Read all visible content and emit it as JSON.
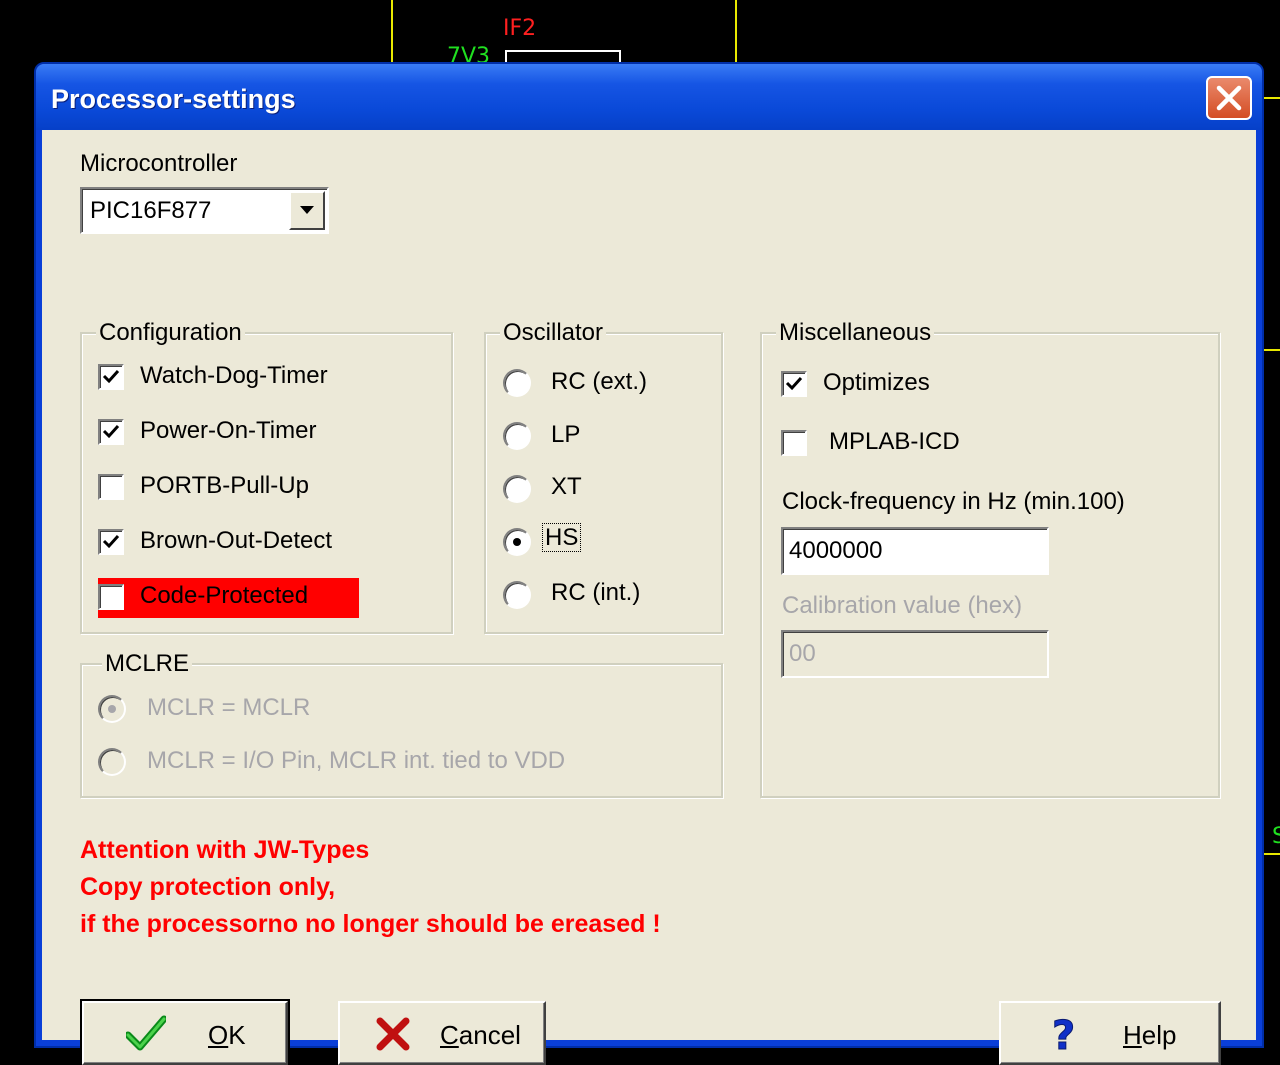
{
  "background": {
    "label_red": "IF2",
    "label_green": "7V3",
    "label_edge": "S"
  },
  "window": {
    "title": "Processor-settings",
    "close_icon": "close-icon"
  },
  "microcontroller": {
    "label": "Microcontroller",
    "selected": "PIC16F877"
  },
  "configuration": {
    "title": "Configuration",
    "items": [
      {
        "label": "Watch-Dog-Timer",
        "checked": true
      },
      {
        "label": "Power-On-Timer",
        "checked": true
      },
      {
        "label": "PORTB-Pull-Up",
        "checked": false
      },
      {
        "label": "Brown-Out-Detect",
        "checked": true
      },
      {
        "label": "Code-Protected",
        "checked": false,
        "highlight": "#ff0000"
      }
    ]
  },
  "oscillator": {
    "title": "Oscillator",
    "options": [
      {
        "label": "RC (ext.)",
        "selected": false
      },
      {
        "label": "LP",
        "selected": false
      },
      {
        "label": "XT",
        "selected": false
      },
      {
        "label": "HS",
        "selected": true
      },
      {
        "label": "RC (int.)",
        "selected": false
      }
    ]
  },
  "miscellaneous": {
    "title": "Miscellaneous",
    "optimizes_label": "Optimizes",
    "optimizes_checked": true,
    "mplab_label": "MPLAB-ICD",
    "mplab_checked": false,
    "clock_label": "Clock-frequency in Hz (min.100)",
    "clock_value": "4000000",
    "calibration_label": "Calibration value (hex)",
    "calibration_value": "00"
  },
  "mclre": {
    "title": "MCLRE",
    "options": [
      {
        "label": "MCLR = MCLR",
        "selected": true
      },
      {
        "label": "MCLR = I/O Pin, MCLR int. tied to VDD",
        "selected": false
      }
    ]
  },
  "warning": {
    "line1": "Attention with JW-Types",
    "line2": "Copy protection only,",
    "line3": "if the processorno no longer should be ereased !",
    "color": "#ff0000"
  },
  "buttons": {
    "ok_first": "O",
    "ok_rest": "K",
    "cancel_first": "C",
    "cancel_rest": "ancel",
    "help_first": "H",
    "help_rest": "elp"
  }
}
